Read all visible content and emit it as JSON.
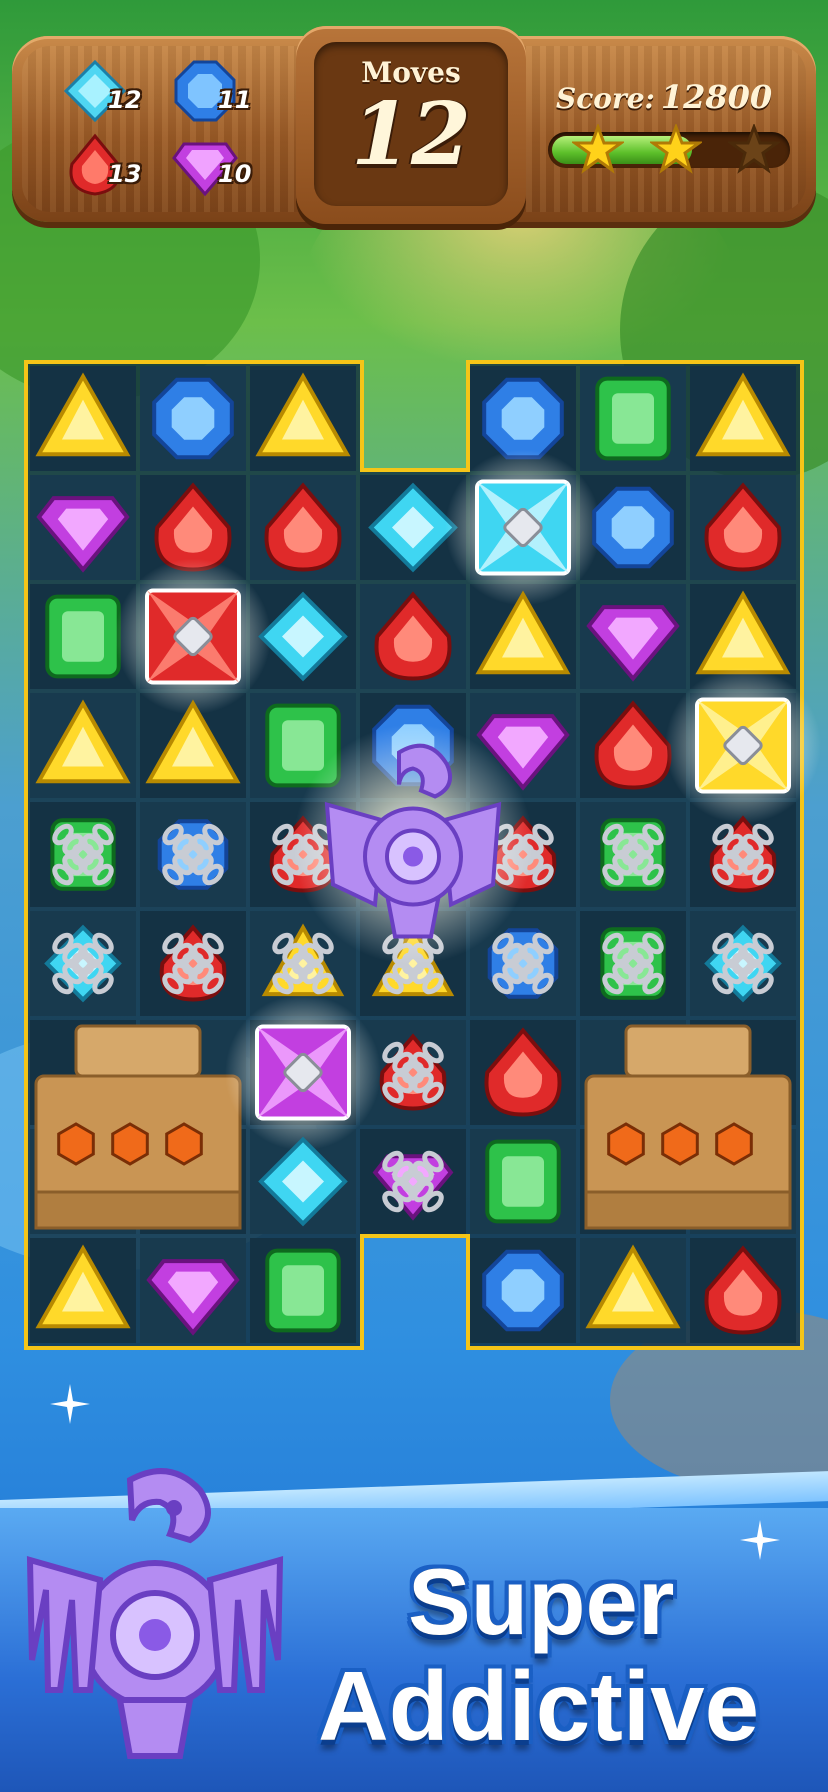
{
  "goals": [
    {
      "gem": "blue-diamond",
      "count": "12"
    },
    {
      "gem": "blue-octagon",
      "count": "11"
    },
    {
      "gem": "red-drop",
      "count": "13"
    },
    {
      "gem": "purple-diamond",
      "count": "10"
    }
  ],
  "moves": {
    "label": "Moves",
    "value": "12"
  },
  "score": {
    "label": "Score:",
    "value": "12800"
  },
  "progress": {
    "fraction": 0.6,
    "stars_earned": 2,
    "stars_total": 3
  },
  "board": {
    "rows": [
      [
        "yellow",
        "blue",
        "yellow",
        "void",
        "blue",
        "green",
        "yellow"
      ],
      [
        "purple",
        "red",
        "red",
        "cyan",
        "cyan-power",
        "blue",
        "red"
      ],
      [
        "green",
        "red-power",
        "cyan",
        "red",
        "yellow",
        "purple",
        "yellow"
      ],
      [
        "yellow",
        "yellow",
        "green",
        "blue",
        "purple",
        "red",
        "yellow-power"
      ],
      [
        "green-chain",
        "blue-chain",
        "red-chain",
        "bird",
        "red-chain",
        "green-chain",
        "red-chain"
      ],
      [
        "cyan-chain",
        "red-chain",
        "yellow-chain",
        "yellow-chain",
        "blue-chain",
        "green-chain",
        "cyan-chain"
      ],
      [
        "altar",
        "altar",
        "purple-power",
        "red-chain",
        "red",
        "altar",
        "altar"
      ],
      [
        "altar",
        "altar",
        "cyan",
        "purple-chain",
        "green",
        "altar",
        "altar"
      ],
      [
        "yellow",
        "purple",
        "green",
        "void",
        "blue",
        "yellow",
        "red"
      ]
    ]
  },
  "banner": {
    "line1": "Super",
    "line2": "Addictive"
  },
  "colors": {
    "accent": "#2b6fd6",
    "wood": "#9a5a26"
  }
}
